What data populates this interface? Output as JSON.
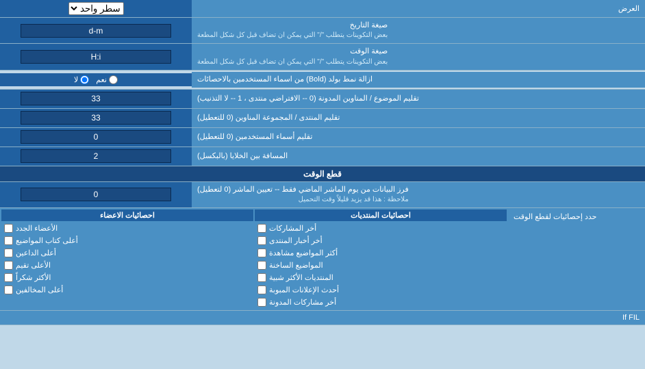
{
  "header": {
    "display_label": "العرض",
    "single_line": "سطر واحد"
  },
  "date_format": {
    "label": "صيغة التاريخ",
    "note": "بعض التكوينات يتطلب \"/\" التي يمكن ان تضاف قبل كل شكل المطعة",
    "value": "d-m"
  },
  "time_format": {
    "label": "صيغة الوقت",
    "note": "بعض التكوينات يتطلب \"/\" التي يمكن ان تضاف قبل كل شكل المطعة",
    "value": "H:i"
  },
  "bold_remove": {
    "label": "ازالة نمط بولد (Bold) من اسماء المستخدمين بالاحصائات",
    "radio_yes": "نعم",
    "radio_no": "لا"
  },
  "topics_titles": {
    "label": "تقليم الموضوع / المناوين المدونة (0 -- الافتراضي منتدى ، 1 -- لا التذنيب)",
    "value": "33"
  },
  "forum_titles": {
    "label": "تقليم المنتدى / المجموعة المناوين (0 للتعطيل)",
    "value": "33"
  },
  "usernames": {
    "label": "تقليم أسماء المستخدمين (0 للتعطيل)",
    "value": "0"
  },
  "cell_spacing": {
    "label": "المسافة بين الخلايا (بالبكسل)",
    "value": "2"
  },
  "time_cut": {
    "section_title": "قطع الوقت",
    "label": "فرز البيانات من يوم الماشر الماضي فقط -- تعيين الماشر (0 لتعطيل)",
    "note": "ملاحظة : هذا قد يزيد قليلاً وقت التحميل",
    "value": "0"
  },
  "stats_limit": {
    "label": "حدد إحصائيات لقطع الوقت"
  },
  "checkboxes": {
    "posts_header": "احصائيات المنتديات",
    "members_header": "احصائيات الاعضاء",
    "posts_items": [
      "أخر المشاركات",
      "أخر أخبار المنتدى",
      "أكثر المواضيع مشاهدة",
      "المواضيع الساخنة",
      "المنتديات الأكثر شبية",
      "أحدث الإعلانات المبوبة",
      "أخر مشاركات المدونة"
    ],
    "members_items": [
      "الأعضاء الجدد",
      "أعلى كتاب المواضيع",
      "أعلى الداعين",
      "الأعلى تقيم",
      "الأكثر شكراً",
      "أعلى المخالفين"
    ]
  }
}
